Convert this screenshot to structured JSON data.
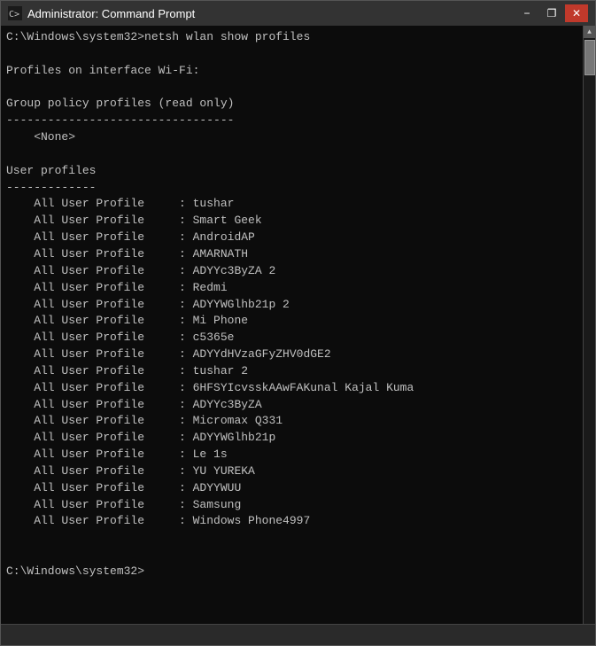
{
  "titleBar": {
    "title": "Administrator: Command Prompt",
    "minimize": "−",
    "maximize": "❐",
    "close": "✕"
  },
  "console": {
    "lines": [
      "C:\\Windows\\system32>netsh wlan show profiles",
      "",
      "Profiles on interface Wi-Fi:",
      "",
      "Group policy profiles (read only)",
      "---------------------------------",
      "    <None>",
      "",
      "User profiles",
      "-------------",
      "    All User Profile     : tushar",
      "    All User Profile     : Smart Geek",
      "    All User Profile     : AndroidAP",
      "    All User Profile     : AMARNATH",
      "    All User Profile     : ADYYc3ByZA 2",
      "    All User Profile     : Redmi",
      "    All User Profile     : ADYYWGlhb21p 2",
      "    All User Profile     : Mi Phone",
      "    All User Profile     : c5365e",
      "    All User Profile     : ADYYdHVzaGFyZHV0dGE2",
      "    All User Profile     : tushar 2",
      "    All User Profile     : 6HFSYIcvsskAAwFAKunal Kajal Kuma",
      "    All User Profile     : ADYYc3ByZA",
      "    All User Profile     : Micromax Q331",
      "    All User Profile     : ADYYWGlhb21p",
      "    All User Profile     : Le 1s",
      "    All User Profile     : YU YUREKA",
      "    All User Profile     : ADYYWUU",
      "    All User Profile     : Samsung",
      "    All User Profile     : Windows Phone4997",
      "",
      "",
      "C:\\Windows\\system32>"
    ]
  }
}
